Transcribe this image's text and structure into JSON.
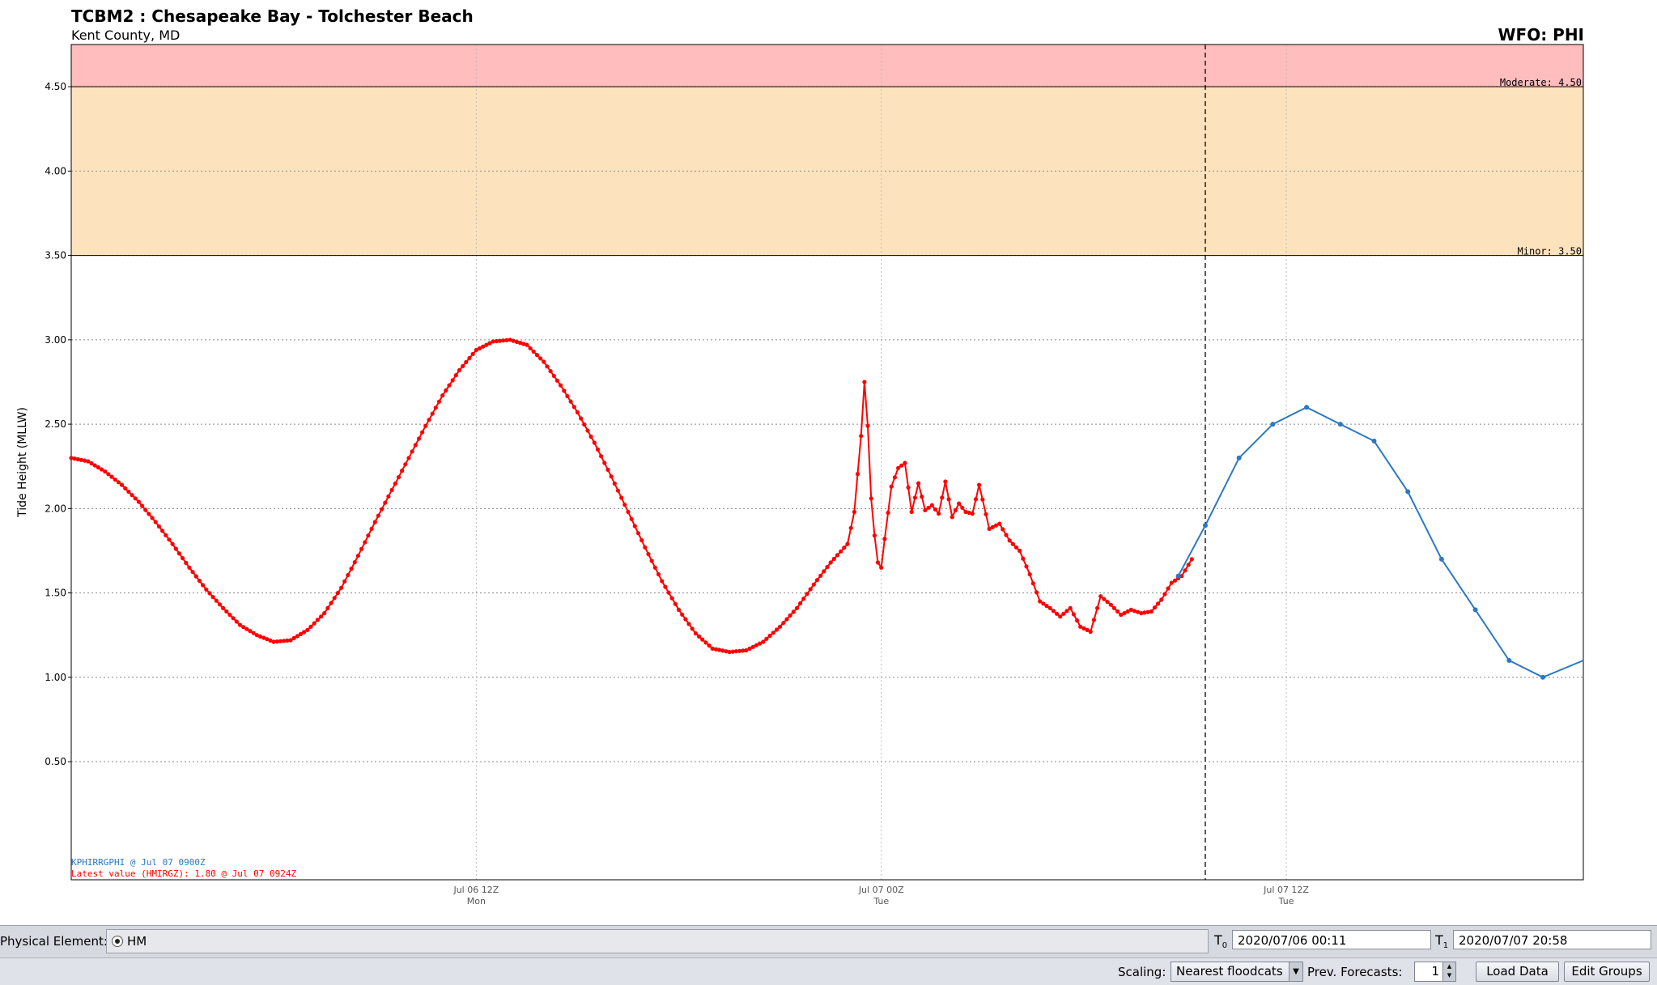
{
  "header": {
    "title": "TCBM2 : Chesapeake Bay - Tolchester Beach",
    "subtitle": "Kent County, MD",
    "wfo": "WFO: PHI"
  },
  "legend": {
    "forecast_source": "KPHIRRGPHI @ Jul 07 0900Z",
    "latest_value": "Latest value (HMIRGZ): 1.80 @ Jul 07 0924Z"
  },
  "colors": {
    "moderate_band": "#ffbdbd",
    "minor_band": "#fde3bd",
    "observed": "#ff0000",
    "forecast": "#2b78c2"
  },
  "chart_data": {
    "type": "line",
    "ylabel": "Tide Height (MLLW)",
    "xlabel": "",
    "ylim": [
      -0.2,
      4.75
    ],
    "xlim_hours_from_jul06_00z": [
      0.0,
      44.8
    ],
    "y_ticks": [
      "0.50",
      "1.00",
      "1.50",
      "2.00",
      "2.50",
      "3.00",
      "3.50",
      "4.00",
      "4.50"
    ],
    "x_ticks": [
      {
        "x": 12,
        "label": "Jul 06 12Z",
        "sublabel": "Mon"
      },
      {
        "x": 24,
        "label": "Jul 07 00Z",
        "sublabel": "Tue"
      },
      {
        "x": 36,
        "label": "Jul 07 12Z",
        "sublabel": "Tue"
      }
    ],
    "grid": true,
    "thresholds": [
      {
        "name": "Minor",
        "label": "Minor: 3.50",
        "value": 3.5
      },
      {
        "name": "Moderate",
        "label": "Moderate: 4.50",
        "value": 4.5
      }
    ],
    "current_time_x": 33.6,
    "series": [
      {
        "name": "Observed",
        "x": [
          0.0,
          0.5,
          1.0,
          1.5,
          2.0,
          2.5,
          3.0,
          3.5,
          4.0,
          4.5,
          5.0,
          5.5,
          6.0,
          6.5,
          7.0,
          7.5,
          8.0,
          8.5,
          9.0,
          9.5,
          10.0,
          10.5,
          11.0,
          11.5,
          12.0,
          12.5,
          13.0,
          13.5,
          14.0,
          14.5,
          15.0,
          15.5,
          16.0,
          16.5,
          17.0,
          17.5,
          18.0,
          18.5,
          19.0,
          19.5,
          20.0,
          20.5,
          21.0,
          21.5,
          22.0,
          22.5,
          23.0,
          23.2,
          23.4,
          23.5,
          23.6,
          23.7,
          23.8,
          23.9,
          24.0,
          24.1,
          24.3,
          24.5,
          24.7,
          24.9,
          25.1,
          25.3,
          25.5,
          25.7,
          25.9,
          26.1,
          26.3,
          26.5,
          26.7,
          26.9,
          27.2,
          27.5,
          27.8,
          28.1,
          28.4,
          28.7,
          29.0,
          29.3,
          29.6,
          29.9,
          30.2,
          30.5,
          30.8,
          31.1,
          31.4,
          31.7,
          32.0,
          32.3,
          32.6,
          32.9,
          33.2
        ],
        "values": [
          2.3,
          2.28,
          2.22,
          2.14,
          2.04,
          1.92,
          1.79,
          1.65,
          1.52,
          1.41,
          1.31,
          1.25,
          1.21,
          1.22,
          1.28,
          1.38,
          1.53,
          1.72,
          1.92,
          2.11,
          2.3,
          2.49,
          2.67,
          2.82,
          2.94,
          2.99,
          3.0,
          2.97,
          2.87,
          2.73,
          2.57,
          2.39,
          2.19,
          1.98,
          1.77,
          1.57,
          1.4,
          1.26,
          1.17,
          1.15,
          1.16,
          1.21,
          1.3,
          1.41,
          1.55,
          1.68,
          1.79,
          1.98,
          2.43,
          2.75,
          2.49,
          2.06,
          1.84,
          1.68,
          1.65,
          1.82,
          2.13,
          2.24,
          2.27,
          1.98,
          2.15,
          1.99,
          2.02,
          1.97,
          2.16,
          1.95,
          2.03,
          1.98,
          1.97,
          2.14,
          1.88,
          1.91,
          1.81,
          1.75,
          1.61,
          1.45,
          1.41,
          1.36,
          1.41,
          1.3,
          1.27,
          1.48,
          1.43,
          1.37,
          1.4,
          1.38,
          1.39,
          1.46,
          1.56,
          1.6,
          1.7
        ]
      },
      {
        "name": "Forecast",
        "x": [
          32.8,
          33.6,
          34.6,
          35.6,
          36.6,
          37.6,
          38.6,
          39.6,
          40.6,
          41.6,
          42.6,
          43.6,
          44.8
        ],
        "values": [
          1.6,
          1.9,
          2.3,
          2.5,
          2.6,
          2.5,
          2.4,
          2.1,
          1.7,
          1.4,
          1.1,
          1.0,
          1.1
        ]
      }
    ]
  },
  "controls": {
    "physical_element_label": "Physical Element:",
    "physical_element_value": "HM",
    "t0_label": "T",
    "t0_sub": "0",
    "t0_value": "2020/07/06 00:11",
    "t1_label": "T",
    "t1_sub": "1",
    "t1_value": "2020/07/07 20:58",
    "scaling_label": "Scaling:",
    "scaling_value": "Nearest floodcats",
    "prev_forecasts_label": "Prev. Forecasts:",
    "prev_forecasts_value": "1",
    "load_data_label": "Load Data",
    "edit_groups_label": "Edit Groups"
  }
}
